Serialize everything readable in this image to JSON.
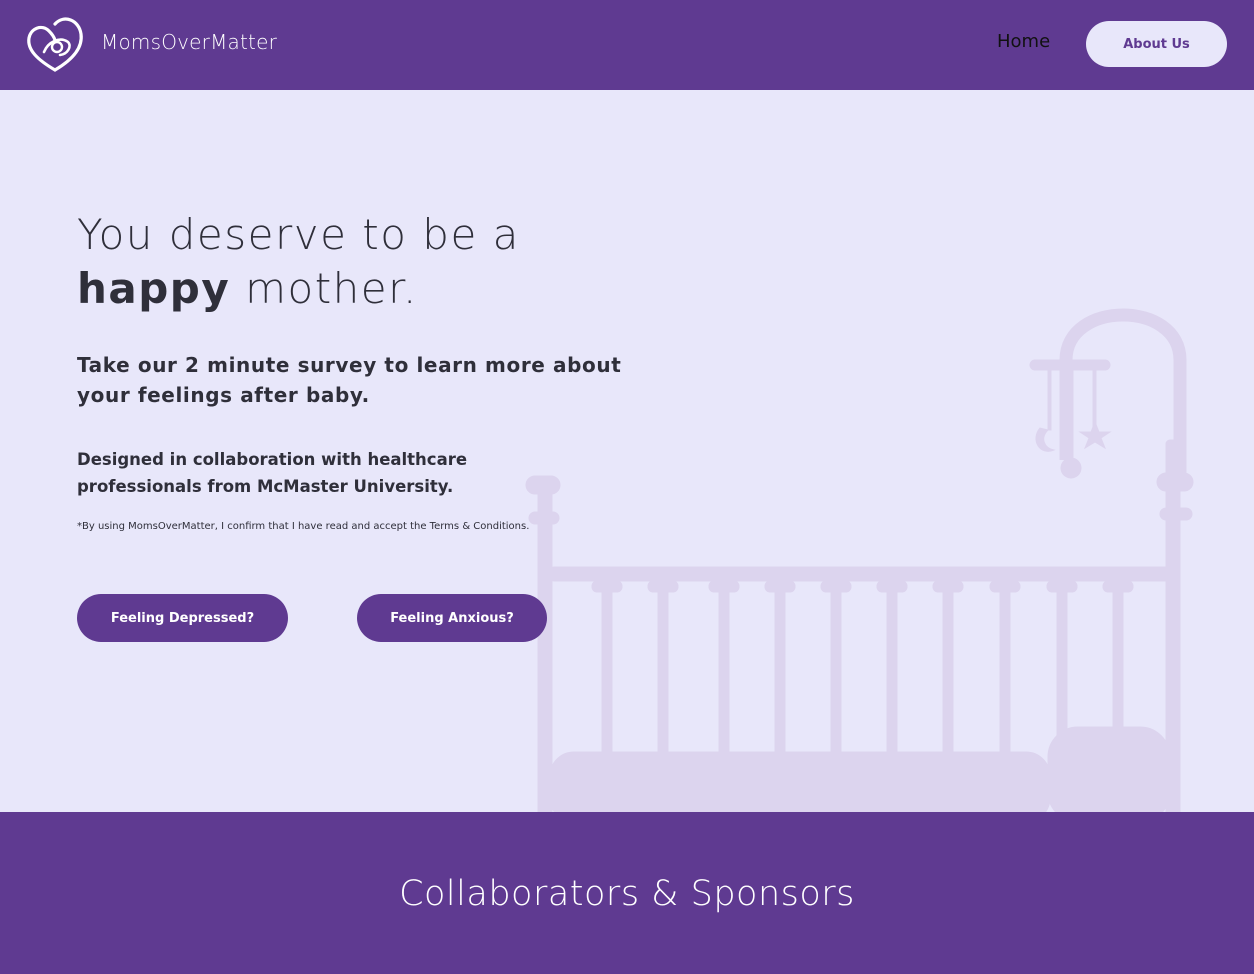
{
  "colors": {
    "brand_purple": "#5F3A91",
    "hero_background": "#E8E7FA",
    "text_dark": "#2F2F3A",
    "crib_illustration": "#DCD4EE"
  },
  "header": {
    "logo_icon": "heart-mother-baby-icon",
    "brand_name": "MomsOverMatter",
    "nav": {
      "home_label": "Home",
      "about_label": "About Us"
    }
  },
  "hero": {
    "headline_line1": "You deserve to be a",
    "headline_emphasis": "happy",
    "headline_rest": " mother.",
    "subheading": "Take our 2 minute survey to learn more about your feelings after baby.",
    "collaboration_text": "Designed in collaboration with healthcare professionals from McMaster University.",
    "disclaimer": "*By using MomsOverMatter, I confirm that I have read and accept the Terms & Conditions.",
    "buttons": {
      "depressed_label": "Feeling Depressed?",
      "anxious_label": "Feeling Anxious?"
    },
    "background_illustration": "crib-with-mobile-illustration"
  },
  "sponsors": {
    "title": "Collaborators & Sponsors"
  }
}
